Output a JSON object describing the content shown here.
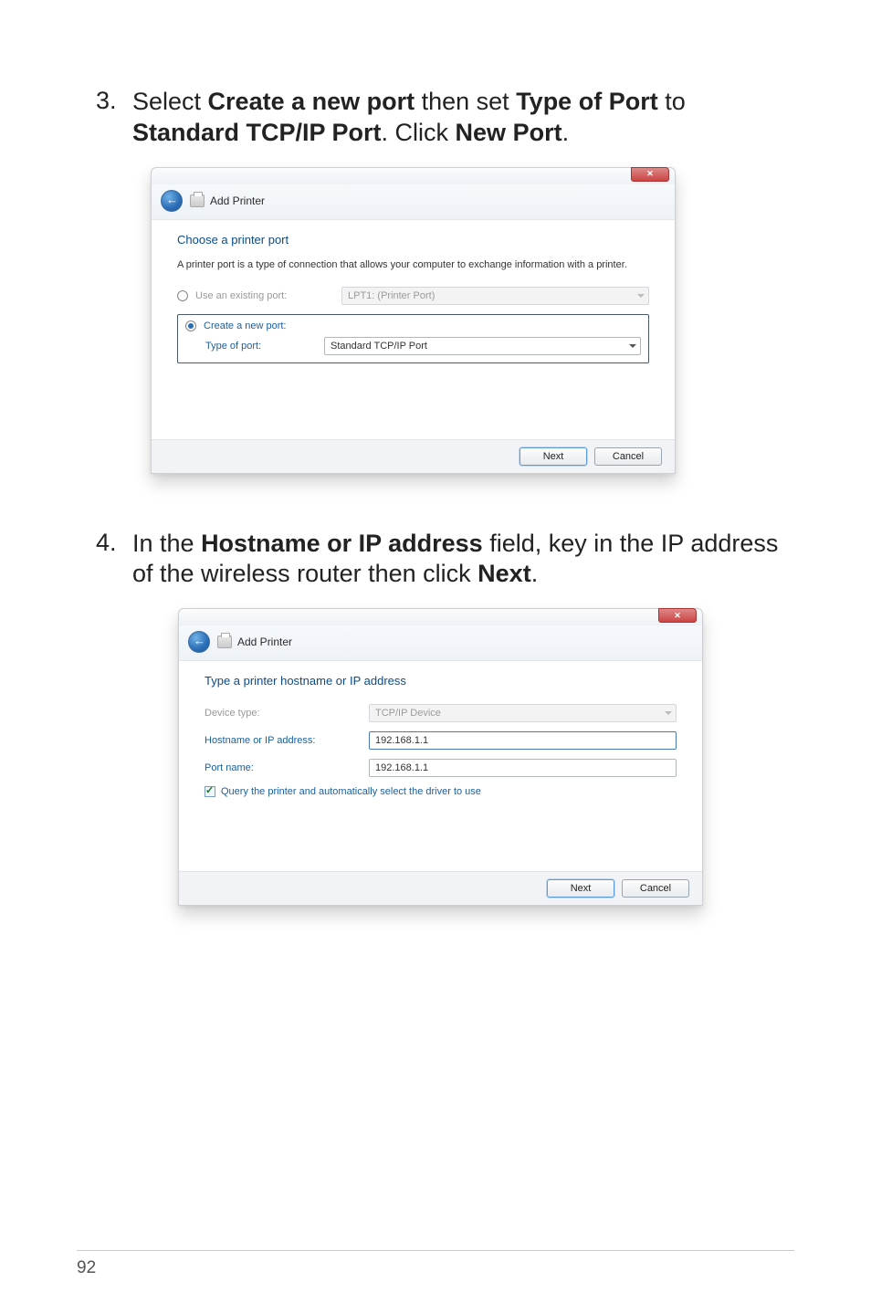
{
  "step3": {
    "number": "3.",
    "text_parts": [
      "Select ",
      "Create a new port",
      " then set ",
      "Type of Port",
      " to ",
      "Standard TCP/IP Port",
      ". Click ",
      "New Port",
      "."
    ]
  },
  "step4": {
    "number": "4.",
    "text_parts": [
      "In the ",
      "Hostname or IP address",
      " field, key in the IP address of the wireless router then click ",
      "Next",
      "."
    ]
  },
  "dialog1": {
    "title": "Add Printer",
    "heading": "Choose a printer port",
    "description": "A printer port is a type of connection that allows your computer to exchange information with a printer.",
    "use_existing_label": "Use an existing port:",
    "use_existing_value": "LPT1: (Printer Port)",
    "create_new_label": "Create a new port:",
    "type_of_port_label": "Type of port:",
    "type_of_port_value": "Standard TCP/IP Port",
    "next": "Next",
    "cancel": "Cancel"
  },
  "dialog2": {
    "title": "Add Printer",
    "heading": "Type a printer hostname or IP address",
    "device_type_label": "Device type:",
    "device_type_value": "TCP/IP Device",
    "hostname_label": "Hostname or IP address:",
    "hostname_value": "192.168.1.1",
    "port_name_label": "Port name:",
    "port_name_value": "192.168.1.1",
    "query_label": "Query the printer and automatically select the driver to use",
    "next": "Next",
    "cancel": "Cancel"
  },
  "page_number": "92"
}
